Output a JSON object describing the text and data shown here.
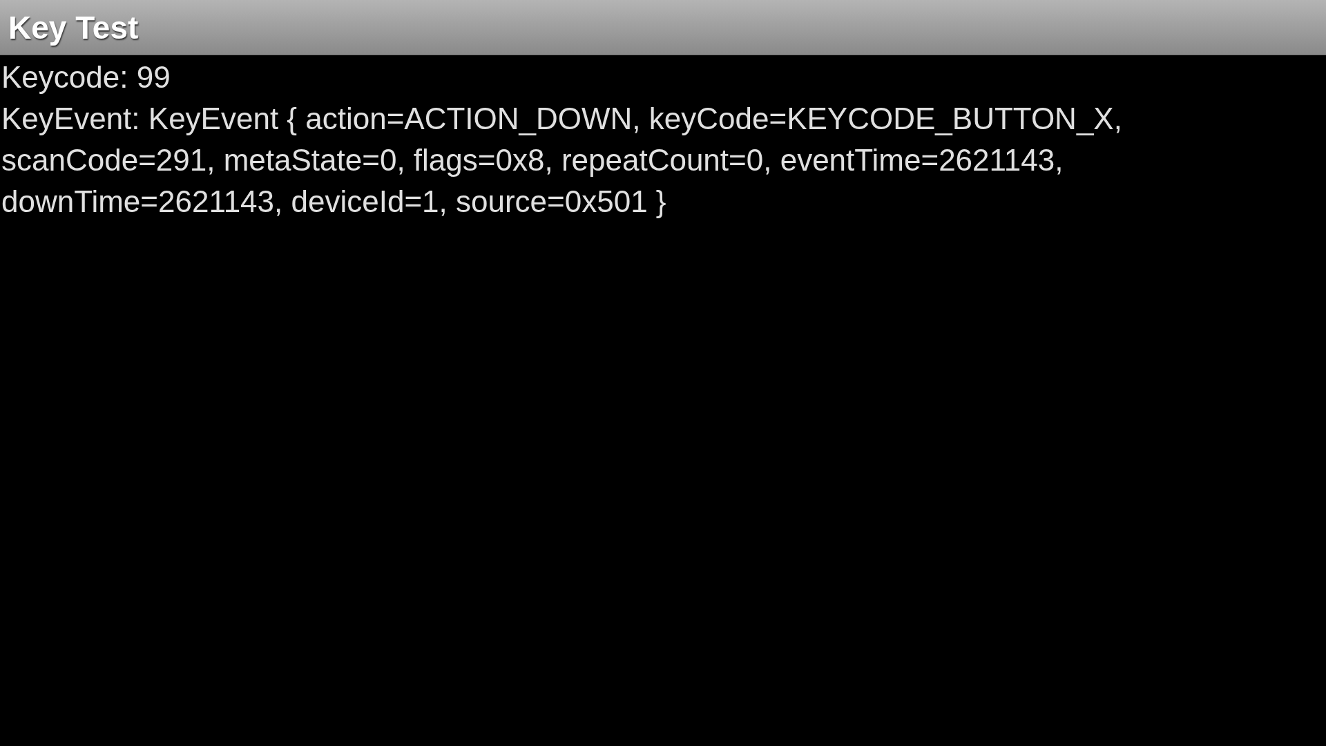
{
  "window": {
    "title": "Key Test"
  },
  "content": {
    "keycode_line": "Keycode: 99",
    "key_event": "KeyEvent: KeyEvent { action=ACTION_DOWN, keyCode=KEYCODE_BUTTON_X, scanCode=291, metaState=0, flags=0x8, repeatCount=0, eventTime=2621143, downTime=2621143, deviceId=1, source=0x501 }"
  }
}
